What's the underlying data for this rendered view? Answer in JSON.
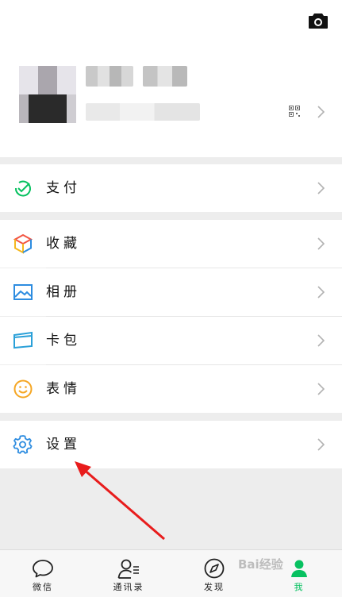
{
  "profile": {
    "camera_icon": "camera-icon",
    "qr_icon": "qr-code-icon"
  },
  "menu": {
    "pay": {
      "label": "支付",
      "icon": "wechat-pay-icon",
      "color": "#07c160"
    },
    "favorites": {
      "label": "收藏",
      "icon": "cube-icon"
    },
    "album": {
      "label": "相册",
      "icon": "image-icon",
      "color": "#2d8ce0"
    },
    "cards": {
      "label": "卡包",
      "icon": "card-icon",
      "color": "#2aa0d8"
    },
    "stickers": {
      "label": "表情",
      "icon": "smiley-icon",
      "color": "#f5a623"
    },
    "settings": {
      "label": "设置",
      "icon": "gear-icon",
      "color": "#2d8ce0"
    }
  },
  "tabbar": {
    "chats": "微信",
    "contacts": "通讯录",
    "discover": "发现",
    "me": "我",
    "active_color": "#07c160"
  },
  "annotation": {
    "arrow_color": "#e81c1c"
  },
  "watermark": "Bai经验"
}
